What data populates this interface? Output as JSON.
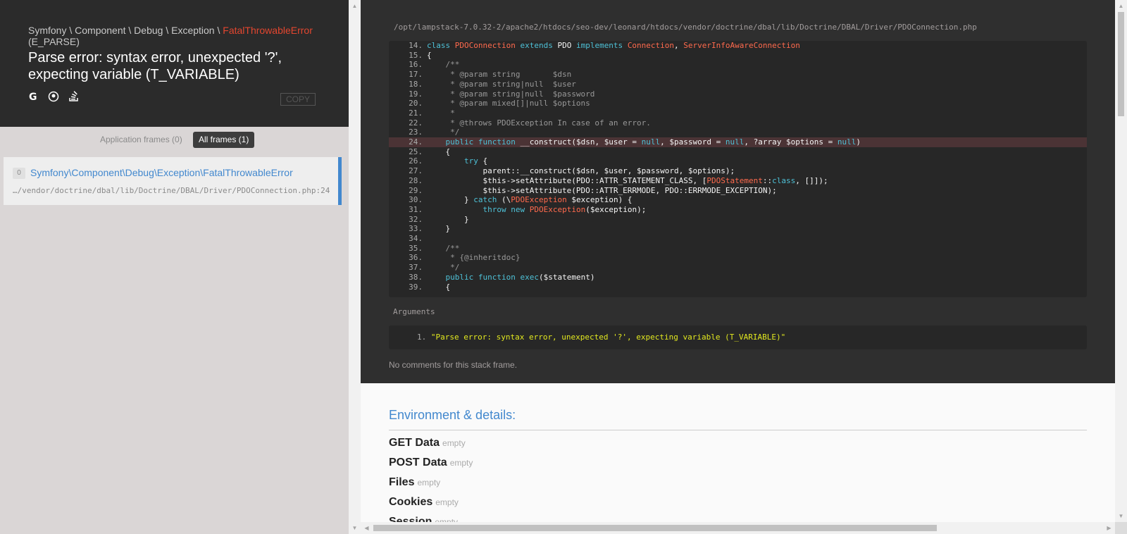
{
  "header": {
    "namespace": "Symfony \\ Component \\ Debug \\ Exception \\ ",
    "exception_class": "FatalThrowableError",
    "error_code": "(E_PARSE)",
    "message": "Parse error: syntax error, unexpected '?', expecting variable (T_VARIABLE)",
    "copy_label": "COPY"
  },
  "links": [
    {
      "icon": "google-icon"
    },
    {
      "icon": "duckduckgo-icon"
    },
    {
      "icon": "stackoverflow-icon"
    }
  ],
  "filters": {
    "app_frames": "Application frames (0)",
    "all_frames": "All frames (1)"
  },
  "frame": {
    "index": "0",
    "class": "Symfony\\Component\\Debug\\Exception\\FatalThrowableError",
    "file": "…/vendor/doctrine/dbal/lib/Doctrine/DBAL/Driver/PDOConnection.php:24"
  },
  "code": {
    "file_path": "/opt/lampstack-7.0.32-2/apache2/htdocs/seo-dev/leonard/htdocs/vendor/doctrine/dbal/lib/Doctrine/DBAL/Driver/PDOConnection.php",
    "highlighted_line": 24,
    "lines": [
      {
        "n": "14.",
        "text": "class PDOConnection extends PDO implements Connection, ServerInfoAwareConnection"
      },
      {
        "n": "15.",
        "text": "{"
      },
      {
        "n": "16.",
        "text": "    /**"
      },
      {
        "n": "17.",
        "text": "     * @param string       $dsn"
      },
      {
        "n": "18.",
        "text": "     * @param string|null  $user"
      },
      {
        "n": "19.",
        "text": "     * @param string|null  $password"
      },
      {
        "n": "20.",
        "text": "     * @param mixed[]|null $options"
      },
      {
        "n": "21.",
        "text": "     *"
      },
      {
        "n": "22.",
        "text": "     * @throws PDOException In case of an error."
      },
      {
        "n": "23.",
        "text": "     */"
      },
      {
        "n": "24.",
        "text": "    public function __construct($dsn, $user = null, $password = null, ?array $options = null)"
      },
      {
        "n": "25.",
        "text": "    {"
      },
      {
        "n": "26.",
        "text": "        try {"
      },
      {
        "n": "27.",
        "text": "            parent::__construct($dsn, $user, $password, $options);"
      },
      {
        "n": "28.",
        "text": "            $this->setAttribute(PDO::ATTR_STATEMENT_CLASS, [PDOStatement::class, []]);"
      },
      {
        "n": "29.",
        "text": "            $this->setAttribute(PDO::ATTR_ERRMODE, PDO::ERRMODE_EXCEPTION);"
      },
      {
        "n": "30.",
        "text": "        } catch (\\PDOException $exception) {"
      },
      {
        "n": "31.",
        "text": "            throw new PDOException($exception);"
      },
      {
        "n": "32.",
        "text": "        }"
      },
      {
        "n": "33.",
        "text": "    }"
      },
      {
        "n": "34.",
        "text": ""
      },
      {
        "n": "35.",
        "text": "    /**"
      },
      {
        "n": "36.",
        "text": "     * {@inheritdoc}"
      },
      {
        "n": "37.",
        "text": "     */"
      },
      {
        "n": "38.",
        "text": "    public function exec($statement)"
      },
      {
        "n": "39.",
        "text": "    {"
      }
    ]
  },
  "arguments": {
    "label": "Arguments",
    "items": [
      "\"Parse error: syntax error, unexpected '?', expecting variable (T_VARIABLE)\""
    ],
    "item_number": "1."
  },
  "no_comments": "No comments for this stack frame.",
  "environment": {
    "title": "Environment & details:",
    "rows": [
      {
        "label": "GET Data",
        "value": "empty"
      },
      {
        "label": "POST Data",
        "value": "empty"
      },
      {
        "label": "Files",
        "value": "empty"
      },
      {
        "label": "Cookies",
        "value": "empty"
      },
      {
        "label": "Session",
        "value": "empty"
      }
    ]
  },
  "colors": {
    "accent": "#4288ce",
    "error": "#e3462f",
    "highlight_line": "#4b3335"
  }
}
